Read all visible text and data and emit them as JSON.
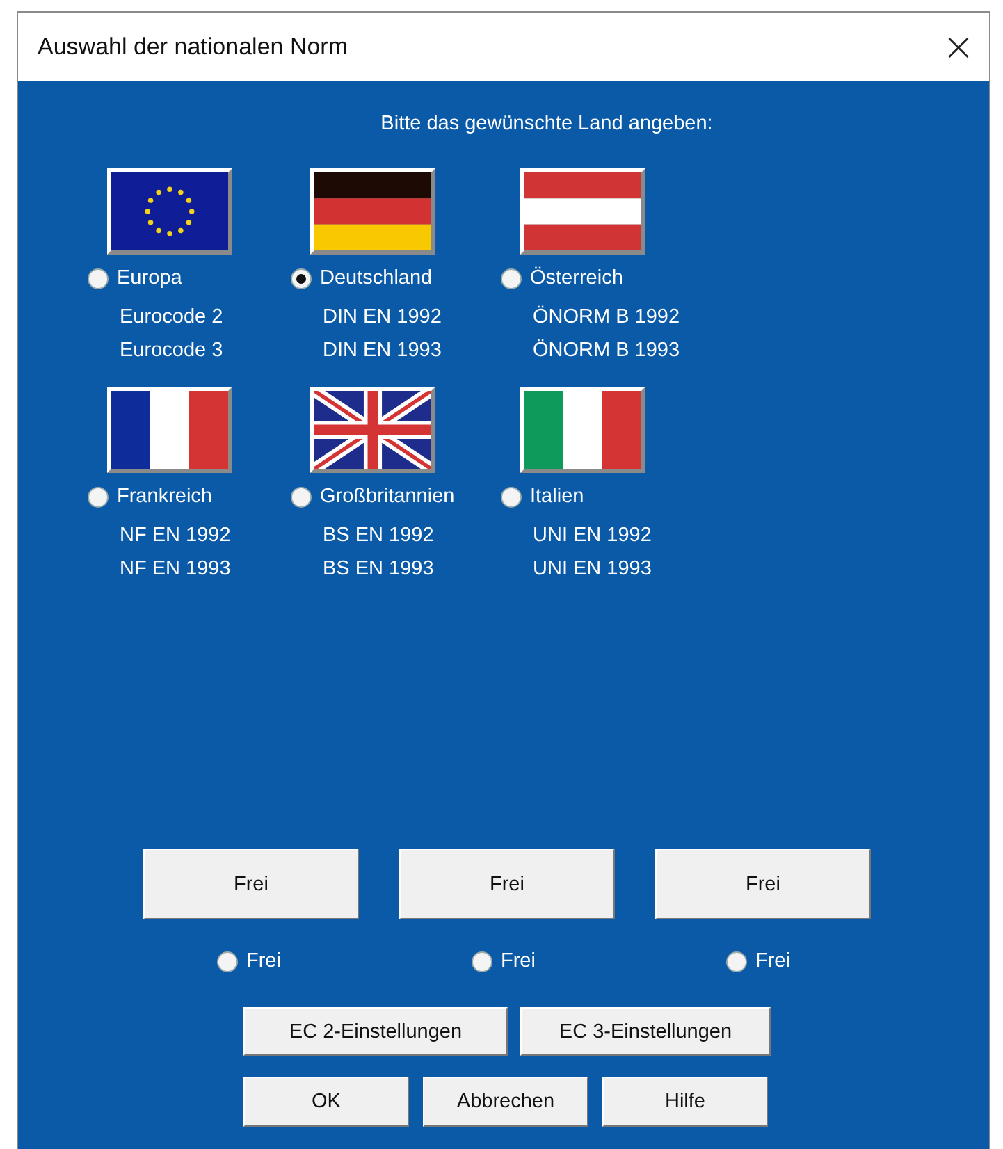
{
  "window": {
    "title": "Auswahl der nationalen Norm",
    "close": "×"
  },
  "prompt": "Bitte das gewünschte Land angeben:",
  "countries": [
    {
      "kind": "eu",
      "name": "Europa",
      "selected": false,
      "norms": [
        "Eurocode 2",
        "Eurocode 3"
      ]
    },
    {
      "kind": "de",
      "name": "Deutschland",
      "selected": true,
      "norms": [
        "DIN EN 1992",
        "DIN EN 1993"
      ]
    },
    {
      "kind": "at",
      "name": "Österreich",
      "selected": false,
      "norms": [
        "ÖNORM B 1992",
        "ÖNORM B 1993"
      ]
    },
    {
      "kind": "fr",
      "name": "Frankreich",
      "selected": false,
      "norms": [
        "NF EN 1992",
        "NF EN 1993"
      ]
    },
    {
      "kind": "gb",
      "name": "Großbritannien",
      "selected": false,
      "norms": [
        "BS EN 1992",
        "BS EN 1993"
      ]
    },
    {
      "kind": "it",
      "name": "Italien",
      "selected": false,
      "norms": [
        "UNI EN 1992",
        "UNI EN 1993"
      ]
    }
  ],
  "free_buttons": [
    "Frei",
    "Frei",
    "Frei"
  ],
  "free_options": [
    {
      "label": "Frei",
      "selected": false
    },
    {
      "label": "Frei",
      "selected": false
    },
    {
      "label": "Frei",
      "selected": false
    }
  ],
  "settings_buttons": [
    "EC 2-Einstellungen",
    "EC 3-Einstellungen"
  ],
  "buttons": [
    "OK",
    "Abbrechen",
    "Hilfe"
  ]
}
